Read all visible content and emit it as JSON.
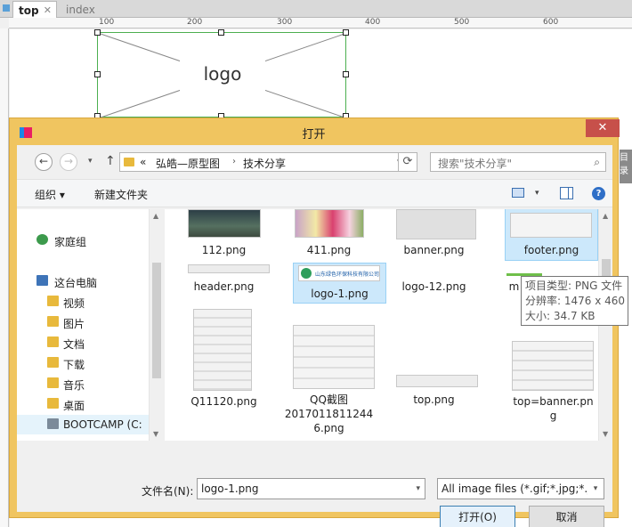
{
  "tool": {
    "tabs": [
      {
        "label": "top",
        "active": true
      },
      {
        "label": "index",
        "active": false
      }
    ],
    "ruler_labels": [
      "100",
      "200",
      "300",
      "400",
      "500",
      "600"
    ],
    "canvas_widget_label": "logo",
    "behind_dialog_fragment": "目录"
  },
  "dialog": {
    "title": "打开",
    "close_glyph": "✕",
    "nav": {
      "back": "←",
      "forward": "→",
      "recent": "▾",
      "up": "↑"
    },
    "address": {
      "overflow": "«",
      "segments": [
        "弘皓—原型图",
        "技术分享"
      ],
      "separator": "›"
    },
    "search": {
      "placeholder": "搜索\"技术分享\"",
      "icon": "⌕"
    },
    "toolbar": {
      "organize": "组织 ▾",
      "new_folder": "新建文件夹",
      "help": "?"
    },
    "tree": [
      {
        "label": "家庭组",
        "icon": "homegroup-icon"
      },
      {
        "label": "这台电脑",
        "icon": "computer-icon"
      },
      {
        "label": "视频",
        "icon": "folder-icon"
      },
      {
        "label": "图片",
        "icon": "folder-icon"
      },
      {
        "label": "文档",
        "icon": "folder-icon"
      },
      {
        "label": "下载",
        "icon": "folder-icon"
      },
      {
        "label": "音乐",
        "icon": "folder-icon"
      },
      {
        "label": "桌面",
        "icon": "folder-icon"
      },
      {
        "label": "BOOTCAMP (C:",
        "icon": "drive-icon"
      }
    ],
    "files": [
      {
        "name": "112.png"
      },
      {
        "name": "411.png"
      },
      {
        "name": "banner.png"
      },
      {
        "name": "footer.png"
      },
      {
        "name": "header.png"
      },
      {
        "name": "logo-1.png",
        "logo_caption": "山东绿色环保科技有限公司"
      },
      {
        "name": "logo-12.png"
      },
      {
        "name": "m"
      },
      {
        "name": "Q11120.png"
      },
      {
        "name": "QQ截图20170118112446.png",
        "lines": [
          "QQ截图",
          "2017011811244",
          "6.png"
        ]
      },
      {
        "name": "top.png"
      },
      {
        "name": "top=banner.png",
        "lines": [
          "top=banner.pn",
          "g"
        ]
      }
    ],
    "selected_file": "logo-1.png",
    "tooltip": {
      "type": "项目类型: PNG 文件",
      "resolution": "分辨率: 1476 x 460",
      "size": "大小: 34.7 KB"
    },
    "filename_label": "文件名(N):",
    "filename_value": "logo-1.png",
    "filetype_value": "All image files (*.gif;*.jpg;*.jp",
    "open_button": "打开(O)",
    "cancel_button": "取消",
    "dropdown_glyph": "▾"
  }
}
